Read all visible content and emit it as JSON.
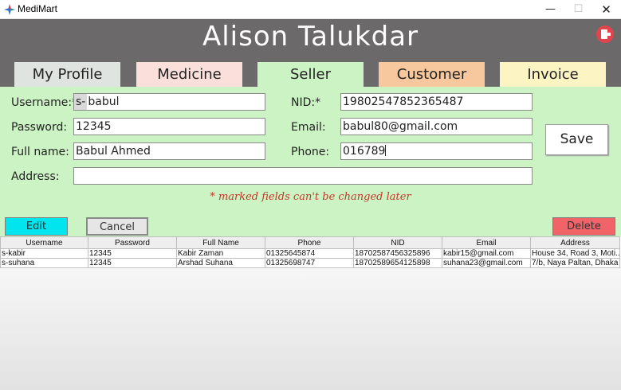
{
  "window": {
    "title": "MediMart",
    "minimize": "—",
    "maximize": "☐",
    "close": "✕"
  },
  "header": {
    "title": "Alison Talukdar"
  },
  "tabs": [
    {
      "label": "My Profile",
      "color": "#dfe4e1"
    },
    {
      "label": "Medicine",
      "color": "#fadfdb"
    },
    {
      "label": "Seller",
      "color": "#ccf3c4",
      "active": true
    },
    {
      "label": "Customer",
      "color": "#f7c79d"
    },
    {
      "label": "Invoice",
      "color": "#fdf4c3"
    }
  ],
  "form": {
    "username_label": "Username:*",
    "username_prefix": "s-",
    "username_value": "babul",
    "password_label": "Password:",
    "password_value": "12345",
    "fullname_label": "Full name:",
    "fullname_value": "Babul Ahmed",
    "address_label": "Address:",
    "address_value": "",
    "nid_label": "NID:*",
    "nid_value": "19802547852365487",
    "email_label": "Email:",
    "email_value": "babul80@gmail.com",
    "phone_label": "Phone:",
    "phone_value": "016789",
    "save_label": "Save",
    "note": "* marked fields can't be changed later"
  },
  "actions": {
    "edit": "Edit",
    "cancel": "Cancel",
    "delete": "Delete"
  },
  "table": {
    "columns": [
      "Username",
      "Password",
      "Full Name",
      "Phone",
      "NID",
      "Email",
      "Address"
    ],
    "rows": [
      [
        "s-kabir",
        "12345",
        "Kabir Zaman",
        "01325645874",
        "18702587456325896",
        "kabir15@gmail.com",
        "House 34, Road 3, Moti..."
      ],
      [
        "s-suhana",
        "12345",
        "Arshad Suhana",
        "01325698747",
        "18702589654125898",
        "suhana23@gmail.com",
        "7/b, Naya Paltan, Dhaka"
      ]
    ]
  },
  "colors": {
    "header_bg": "#6b696a",
    "panel_bg": "#ccf3c4",
    "edit_btn": "#00e5ee",
    "delete_btn": "#f06469",
    "note_text": "#c0392b",
    "logout_icon": "#e0454e"
  }
}
